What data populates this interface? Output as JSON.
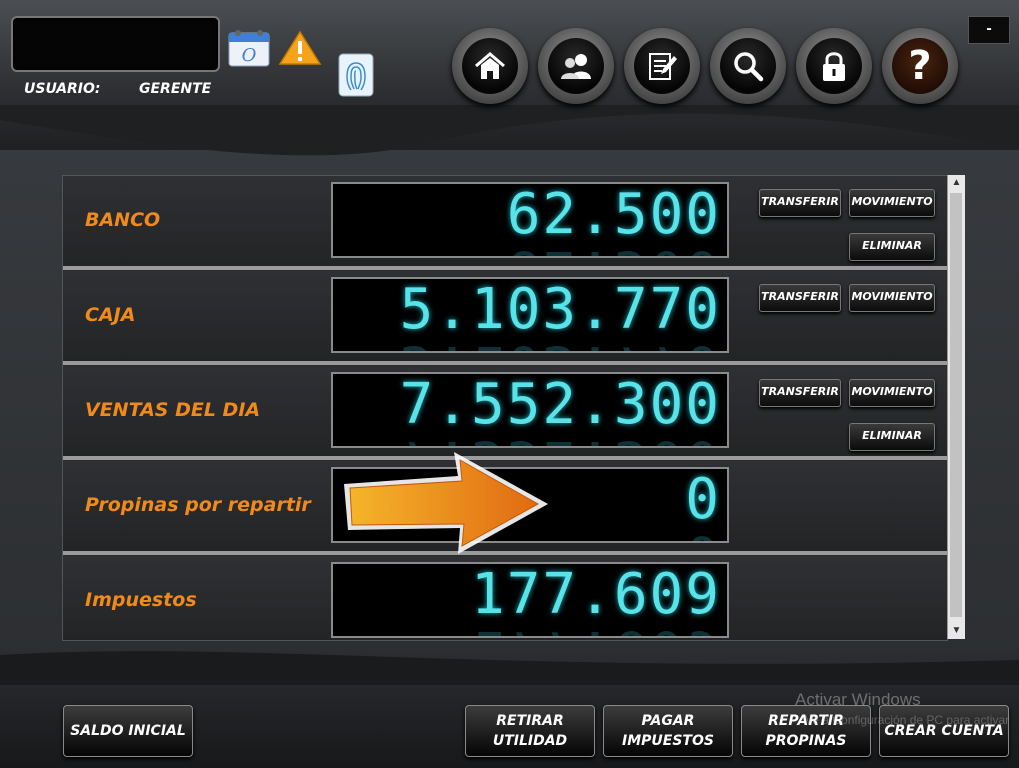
{
  "header": {
    "user_label": "USUARIO:",
    "user_value": "GERENTE",
    "minimize_label": "-"
  },
  "nav": [
    {
      "name": "home-icon"
    },
    {
      "name": "users-icon"
    },
    {
      "name": "notes-edit-icon"
    },
    {
      "name": "search-icon"
    },
    {
      "name": "lock-icon"
    },
    {
      "name": "help-icon",
      "label": "?"
    }
  ],
  "accounts": [
    {
      "label": "BANCO",
      "value": "62.500",
      "buttons": {
        "transfer": "TRANSFERIR",
        "movement": "MOVIMIENTO",
        "delete": "ELIMINAR"
      }
    },
    {
      "label": "CAJA",
      "value": "5.103.770",
      "buttons": {
        "transfer": "TRANSFERIR",
        "movement": "MOVIMIENTO"
      }
    },
    {
      "label": "VENTAS DEL DIA",
      "value": "7.552.300",
      "buttons": {
        "transfer": "TRANSFERIR",
        "movement": "MOVIMIENTO",
        "delete": "ELIMINAR"
      }
    },
    {
      "label": "Propinas por repartir",
      "value": "0"
    },
    {
      "label": "Impuestos",
      "value": "177.609"
    }
  ],
  "footer": {
    "saldo_inicial": "SALDO INICIAL",
    "retirar_line1": "RETIRAR",
    "retirar_line2": "UTILIDAD",
    "pagar_line1": "PAGAR",
    "pagar_line2": "IMPUESTOS",
    "repartir_line1": "REPARTIR",
    "repartir_line2": "PROPINAS",
    "crear_cuenta": "CREAR CUENTA"
  },
  "watermark": {
    "line1": "Activar Windows",
    "line2": "Ve a Configuración de PC para activar"
  },
  "colors": {
    "label_orange": "#f08a1a",
    "lcd_cyan": "#57e3e8",
    "arrow_orange": "#f0a020"
  }
}
